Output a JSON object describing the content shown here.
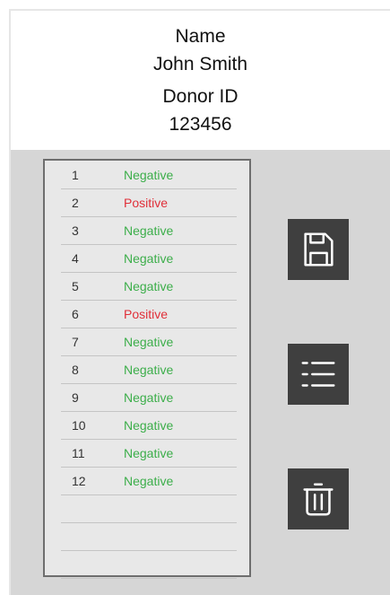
{
  "header": {
    "name_label": "Name",
    "name_value": "John Smith",
    "donor_label": "Donor ID",
    "donor_value": "123456"
  },
  "results": [
    {
      "num": "1",
      "status": "Negative"
    },
    {
      "num": "2",
      "status": "Positive"
    },
    {
      "num": "3",
      "status": "Negative"
    },
    {
      "num": "4",
      "status": "Negative"
    },
    {
      "num": "5",
      "status": "Negative"
    },
    {
      "num": "6",
      "status": "Positive"
    },
    {
      "num": "7",
      "status": "Negative"
    },
    {
      "num": "8",
      "status": "Negative"
    },
    {
      "num": "9",
      "status": "Negative"
    },
    {
      "num": "10",
      "status": "Negative"
    },
    {
      "num": "11",
      "status": "Negative"
    },
    {
      "num": "12",
      "status": "Negative"
    },
    {
      "num": "",
      "status": ""
    },
    {
      "num": "",
      "status": ""
    },
    {
      "num": "",
      "status": ""
    }
  ],
  "actions": {
    "save_icon": "save-icon",
    "list_icon": "list-icon",
    "delete_icon": "trash-icon"
  },
  "colors": {
    "negative": "#3cae4a",
    "positive": "#e0303a",
    "button": "#3f3f3f",
    "panel": "#d6d6d6"
  }
}
